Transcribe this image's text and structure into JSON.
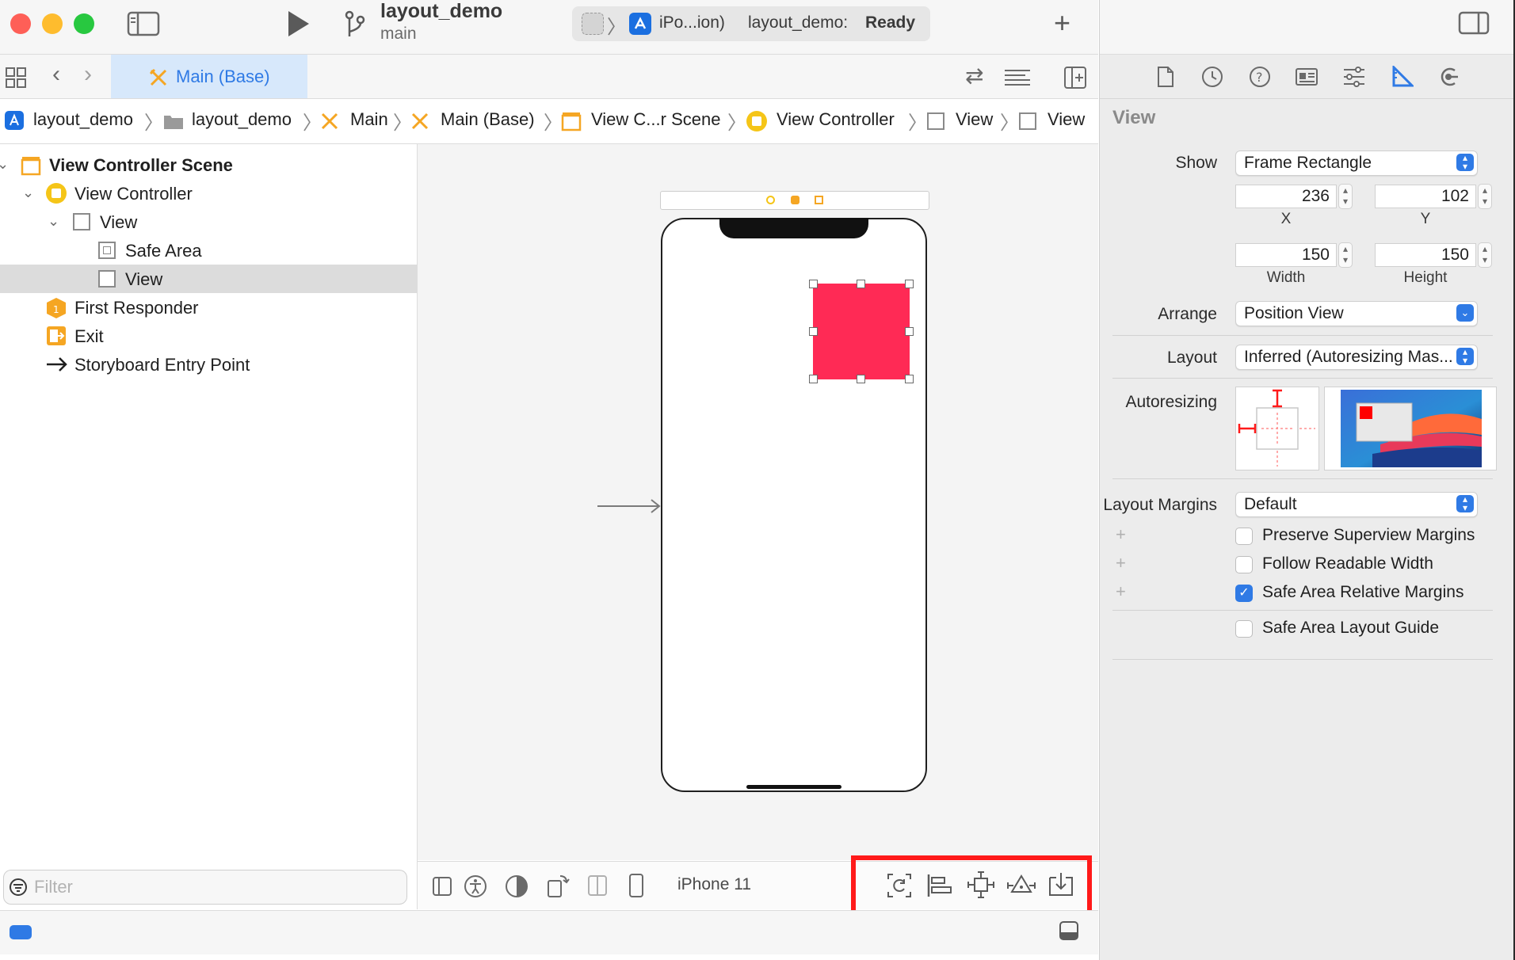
{
  "toolbar": {
    "project_name": "layout_demo",
    "branch": "main",
    "device_short": "iPo...ion)",
    "status_target": "layout_demo:",
    "status_state": "Ready"
  },
  "editor_tab": {
    "label": "Main (Base)"
  },
  "jump_bar": [
    "layout_demo",
    "layout_demo",
    "Main",
    "Main (Base)",
    "View C...r Scene",
    "View Controller",
    "View",
    "View"
  ],
  "navigator": {
    "rows": [
      {
        "label": "View Controller Scene"
      },
      {
        "label": "View Controller"
      },
      {
        "label": "View"
      },
      {
        "label": "Safe Area"
      },
      {
        "label": "View"
      },
      {
        "label": "First Responder"
      },
      {
        "label": "Exit"
      },
      {
        "label": "Storyboard Entry Point"
      }
    ],
    "filter_placeholder": "Filter"
  },
  "canvas": {
    "device_label": "iPhone 11"
  },
  "inspector": {
    "section_title": "View",
    "show_label": "Show",
    "show_value": "Frame Rectangle",
    "x": "236",
    "y": "102",
    "width": "150",
    "height": "150",
    "x_label": "X",
    "y_label": "Y",
    "width_label": "Width",
    "height_label": "Height",
    "arrange_label": "Arrange",
    "arrange_value": "Position View",
    "layout_label": "Layout",
    "layout_value": "Inferred (Autoresizing Mas...",
    "autoresizing_label": "Autoresizing",
    "margins_label": "Layout Margins",
    "margins_value": "Default",
    "checkboxes": [
      {
        "label": "Preserve Superview Margins",
        "checked": false
      },
      {
        "label": "Follow Readable Width",
        "checked": false
      },
      {
        "label": "Safe Area Relative Margins",
        "checked": true
      },
      {
        "label": "Safe Area Layout Guide",
        "checked": false
      }
    ]
  },
  "colors": {
    "accent": "#2f7ae5",
    "selected_view": "#ff2a55",
    "highlight": "#ff1a1a",
    "storyboard_icon": "#f5a623"
  }
}
